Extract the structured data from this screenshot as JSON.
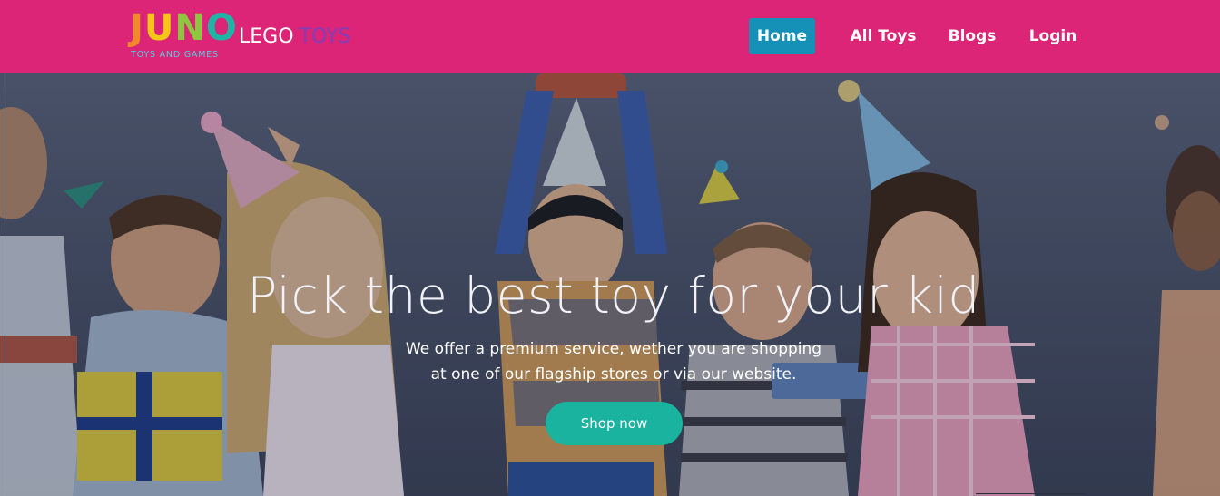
{
  "logo": {
    "letters": [
      {
        "char": "J",
        "color": "#f28a2b"
      },
      {
        "char": "U",
        "color": "#f5c518"
      },
      {
        "char": "N",
        "color": "#8dc63f"
      },
      {
        "char": "O",
        "color": "#1fb5a6"
      }
    ],
    "tagline": "TOYS AND GAMES",
    "tagline_color": "#4fd0e3"
  },
  "brand": {
    "word1": "LEGO",
    "word2": "TOYS"
  },
  "nav": {
    "items": [
      {
        "label": "Home",
        "active": true
      },
      {
        "label": "All Toys",
        "active": false
      },
      {
        "label": "Blogs",
        "active": false
      },
      {
        "label": "Login",
        "active": false
      }
    ]
  },
  "hero": {
    "title": "Pick the best toy for your kid",
    "subtitle_line1": "We offer a premium service, wether you are shopping",
    "subtitle_line2": "at one of our flagship stores or via our website.",
    "cta_label": "Shop now"
  },
  "colors": {
    "navbar_bg": "#dc2577",
    "nav_active_bg": "#1591b8",
    "brand_accent": "#7f3fb8",
    "cta_bg": "#1ab3a0"
  }
}
